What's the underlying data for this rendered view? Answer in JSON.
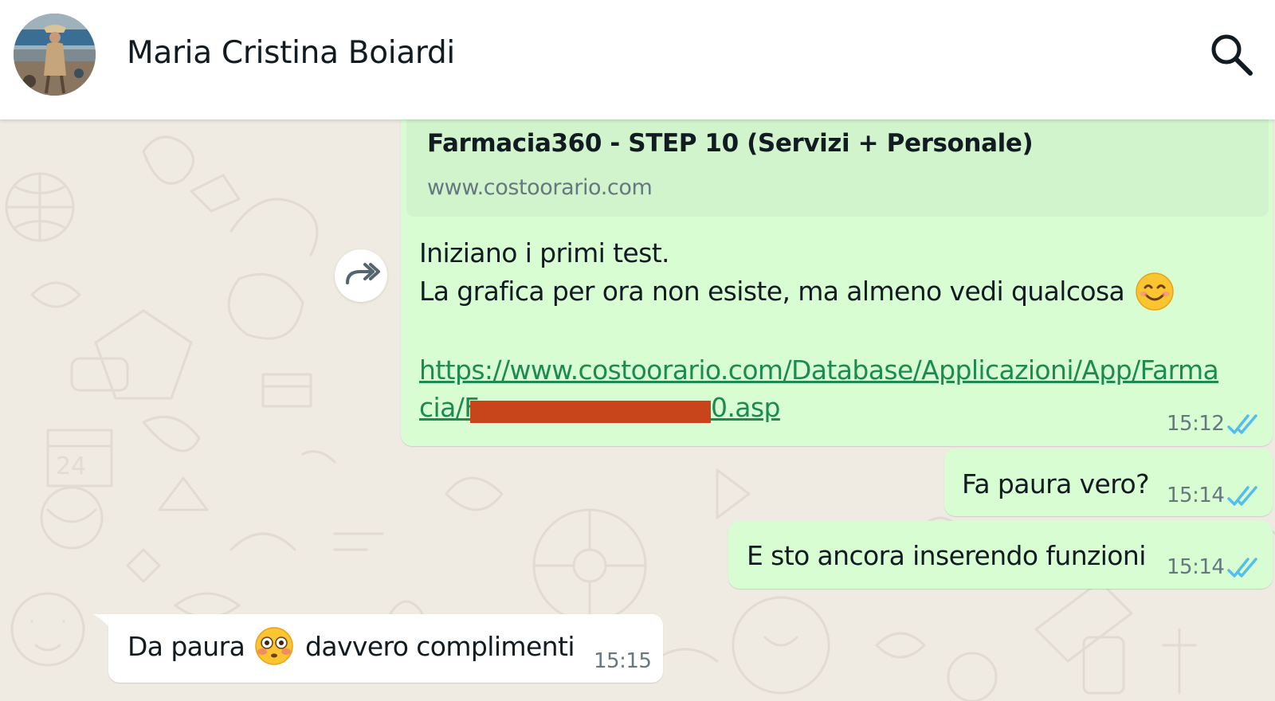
{
  "colors": {
    "wallpaper": "#efeae2",
    "outgoing_bubble": "#d9fdd3",
    "incoming_bubble": "#ffffff",
    "read_ticks": "#53bdeb",
    "link": "#1d8a4f"
  },
  "header": {
    "contact_name": "Maria Cristina Boiardi",
    "avatar_icon": "contact-photo",
    "search_icon": "search-icon"
  },
  "messages": {
    "m1": {
      "preview_title": "Farmacia360 - STEP 10 (Servizi + Personale)",
      "preview_domain": "www.costoorario.com",
      "line1": "Iniziano i primi test.",
      "line2": "La grafica per ora non esiste, ma almeno vedi qualcosa",
      "emoji": "smiling-face-emoji",
      "link_line1": "https://www.costoorario.com/Database/Applicazioni/App/Farma",
      "link_line2_start": "cia/F",
      "link_line2_end": "0.asp",
      "time": "15:12",
      "status": "read"
    },
    "m2": {
      "text": "Fa paura vero?",
      "time": "15:14",
      "status": "read"
    },
    "m3": {
      "text": "E sto ancora inserendo funzioni",
      "time": "15:14",
      "status": "read"
    },
    "m4": {
      "text_before": "Da paura",
      "emoji": "flushed-face-emoji",
      "text_after": "davvero complimenti",
      "time": "15:15"
    }
  },
  "forward_icon": "forward-icon"
}
